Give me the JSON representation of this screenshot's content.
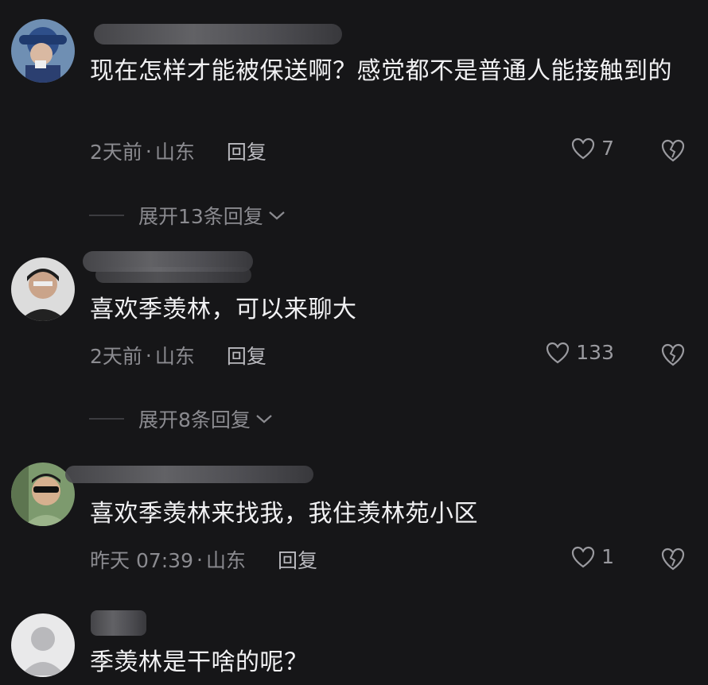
{
  "comments": [
    {
      "text": "现在怎样才能被保送啊？感觉都不是普通人能接触到的",
      "time": "2天前",
      "location": "山东",
      "reply_label": "回复",
      "likes": "7",
      "expand_label": "展开13条回复"
    },
    {
      "text": "喜欢季羡林，可以来聊大",
      "time": "2天前",
      "location": "山东",
      "reply_label": "回复",
      "likes": "133",
      "expand_label": "展开8条回复"
    },
    {
      "text": "喜欢季羡林来找我，我住羡林苑小区",
      "time": "昨天 07:39",
      "location": "山东",
      "reply_label": "回复",
      "likes": "1"
    },
    {
      "text": "季羡林是干啥的呢？"
    }
  ],
  "separator": "·",
  "icons": {
    "like": "heart-outline-icon",
    "dislike": "broken-heart-icon",
    "expand": "chevron-down-icon"
  },
  "colors": {
    "background": "#161618",
    "text": "#f1f1f3",
    "meta": "#8b8b90"
  }
}
